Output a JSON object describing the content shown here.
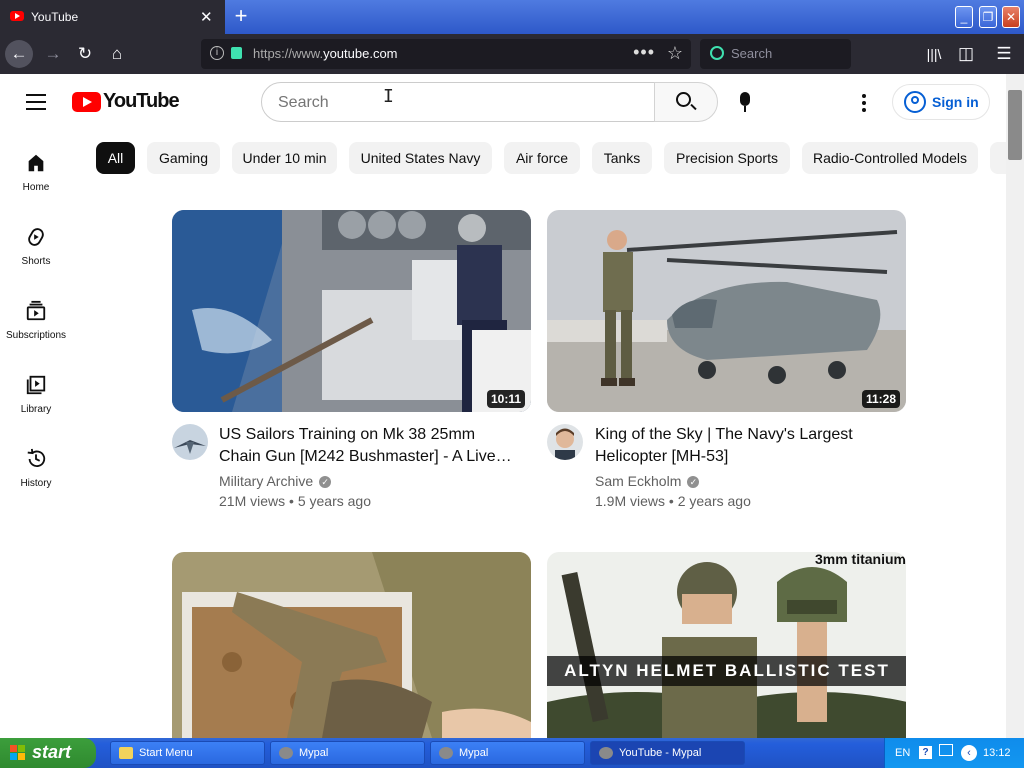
{
  "browser": {
    "tab_title": "YouTube",
    "url_prefix": "https://www.",
    "url_domain": "youtube.com",
    "search_placeholder": "Search"
  },
  "youtube": {
    "logo_text": "YouTube",
    "search_placeholder": "Search",
    "sign_in_label": "Sign in"
  },
  "sidebar": {
    "items": [
      {
        "label": "Home",
        "icon": "home-icon"
      },
      {
        "label": "Shorts",
        "icon": "shorts-icon"
      },
      {
        "label": "Subscriptions",
        "icon": "subscriptions-icon"
      },
      {
        "label": "Library",
        "icon": "library-icon"
      },
      {
        "label": "History",
        "icon": "history-icon"
      }
    ]
  },
  "chips": [
    "All",
    "Gaming",
    "Under 10 min",
    "United States Navy",
    "Air force",
    "Tanks",
    "Precision Sports",
    "Radio-Controlled Models"
  ],
  "videos": [
    {
      "title": "US Sailors Training on Mk 38 25mm Chain Gun [M242 Bushmaster] - A Live…",
      "channel": "Military Archive",
      "views": "21M views",
      "age": "5 years ago",
      "duration": "10:11"
    },
    {
      "title": "King of the Sky | The Navy's Largest Helicopter [MH-53]",
      "channel": "Sam Eckholm",
      "views": "1.9M views",
      "age": "2 years ago",
      "duration": "11:28"
    },
    {
      "duration": ""
    },
    {
      "overlay_text": "ALTYN HELMET BALLISTIC TEST",
      "overlay_corner": "3mm titanium",
      "duration": ""
    }
  ],
  "taskbar": {
    "start_label": "start",
    "buttons": [
      "Start Menu",
      "Mypal",
      "Mypal",
      "YouTube - Mypal"
    ],
    "language": "EN",
    "time": "13:12"
  },
  "colors": {
    "youtube_red": "#ff0000",
    "link_blue": "#065fd4",
    "chip_selected": "#0f0f0f",
    "browser_dark": "#2b2a33",
    "xp_blue": "#245edb",
    "xp_green": "#3c9e3c"
  }
}
